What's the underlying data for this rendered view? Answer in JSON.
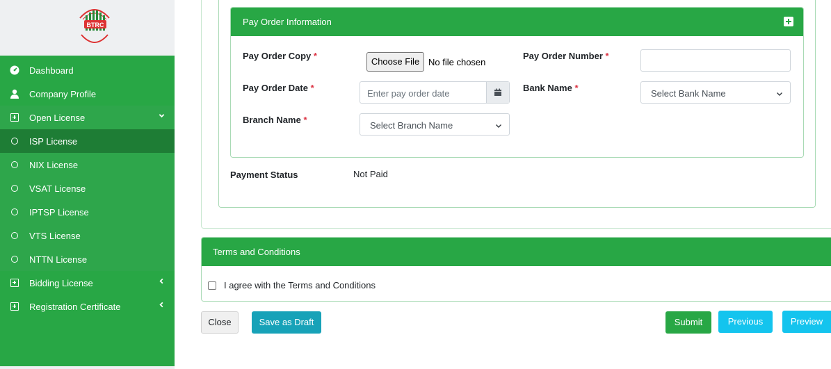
{
  "colors": {
    "primary_green": "#28a745",
    "active_green": "#1e7d35",
    "info": "#17a2b8",
    "light_blue": "#14c4ee",
    "required": "#dc3545"
  },
  "logo": {
    "text": "BTRC",
    "icon": "btrc-logo"
  },
  "sidebar": {
    "items": [
      {
        "label": "Dashboard",
        "icon": "dashboard-icon"
      },
      {
        "label": "Company Profile",
        "icon": "user-icon"
      },
      {
        "label": "Open License",
        "icon": "plus-square-icon",
        "expanded": true
      },
      {
        "label": "ISP License",
        "icon": "circle-icon",
        "active": true
      },
      {
        "label": "NIX License",
        "icon": "circle-icon"
      },
      {
        "label": "VSAT License",
        "icon": "circle-icon"
      },
      {
        "label": "IPTSP License",
        "icon": "circle-icon"
      },
      {
        "label": "VTS License",
        "icon": "circle-icon"
      },
      {
        "label": "NTTN License",
        "icon": "circle-icon"
      },
      {
        "label": "Bidding License",
        "icon": "plus-square-icon"
      },
      {
        "label": "Registration Certificate",
        "icon": "plus-square-icon"
      }
    ]
  },
  "pay_order": {
    "title": "Pay Order Information",
    "copy_label": "Pay Order Copy",
    "choose_file": "Choose File",
    "no_file": "No file chosen",
    "number_label": "Pay Order Number",
    "number_value": "",
    "date_label": "Pay Order Date",
    "date_placeholder": "Enter pay order date",
    "bank_label": "Bank Name",
    "bank_value": "Select Bank Name",
    "branch_label": "Branch Name",
    "branch_value": "Select Branch Name",
    "required_mark": "*"
  },
  "payment": {
    "label": "Payment Status",
    "value": "Not Paid"
  },
  "terms": {
    "title": "Terms and Conditions",
    "agree_text": "I agree with the Terms and Conditions",
    "checked": false
  },
  "actions": {
    "close": "Close",
    "draft": "Save as Draft",
    "submit": "Submit",
    "previous": "Previous",
    "preview": "Preview"
  }
}
